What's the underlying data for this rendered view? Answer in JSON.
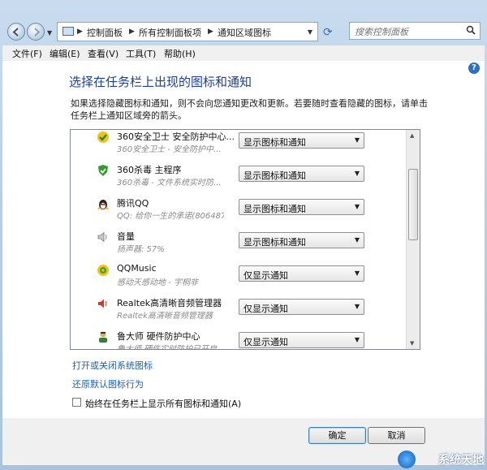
{
  "address": {
    "crumbs": [
      "控制面板",
      "所有控制面板项",
      "通知区域图标"
    ]
  },
  "search": {
    "placeholder": "搜索控制面板"
  },
  "menu": [
    "文件(F)",
    "编辑(E)",
    "查看(V)",
    "工具(T)",
    "帮助(H)"
  ],
  "page": {
    "title": "选择在任务栏上出现的图标和通知",
    "description": "如果选择隐藏图标和通知，则不会向您通知更改和更新。若要随时查看隐藏的图标，请单击任务栏上通知区域旁的箭头。"
  },
  "items": [
    {
      "name": "360安全卫士 安全防护中心...",
      "sub": "360安全卫士 - 安全防护中...",
      "behavior": "显示图标和通知",
      "icon": "360-safe-icon"
    },
    {
      "name": "360杀毒 主程序",
      "sub": "360杀毒 - 文件系统实时防...",
      "behavior": "显示图标和通知",
      "icon": "360-antivirus-icon"
    },
    {
      "name": "腾讯QQ",
      "sub": "QQ: 给你一生的承诺(806487...",
      "behavior": "显示图标和通知",
      "icon": "qq-icon"
    },
    {
      "name": "音量",
      "sub": "扬声器: 57%",
      "behavior": "显示图标和通知",
      "icon": "volume-icon"
    },
    {
      "name": "QQMusic",
      "sub": "感动天感动地 - 宇桐非",
      "behavior": "仅显示通知",
      "icon": "qqmusic-icon"
    },
    {
      "name": "Realtek高清晰音频管理器",
      "sub": "Realtek高清晰音频管理器",
      "behavior": "仅显示通知",
      "icon": "realtek-speaker-icon"
    },
    {
      "name": "鲁大师 硬件防护中心",
      "sub": "鲁大师 硬件实时防护已开启",
      "behavior": "仅显示通知",
      "icon": "ludashi-icon"
    }
  ],
  "links": {
    "system_icons": "打开或关闭系统图标",
    "restore": "还原默认图标行为"
  },
  "always_show": {
    "label": "始终在任务栏上显示所有图标和通知(A)",
    "checked": false
  },
  "buttons": {
    "ok": "确定",
    "cancel": "取消"
  },
  "watermark": "系统天地",
  "colors": {
    "title": "#1b3f9a",
    "link": "#1c5fb5",
    "frame": "#b7cfe6"
  }
}
